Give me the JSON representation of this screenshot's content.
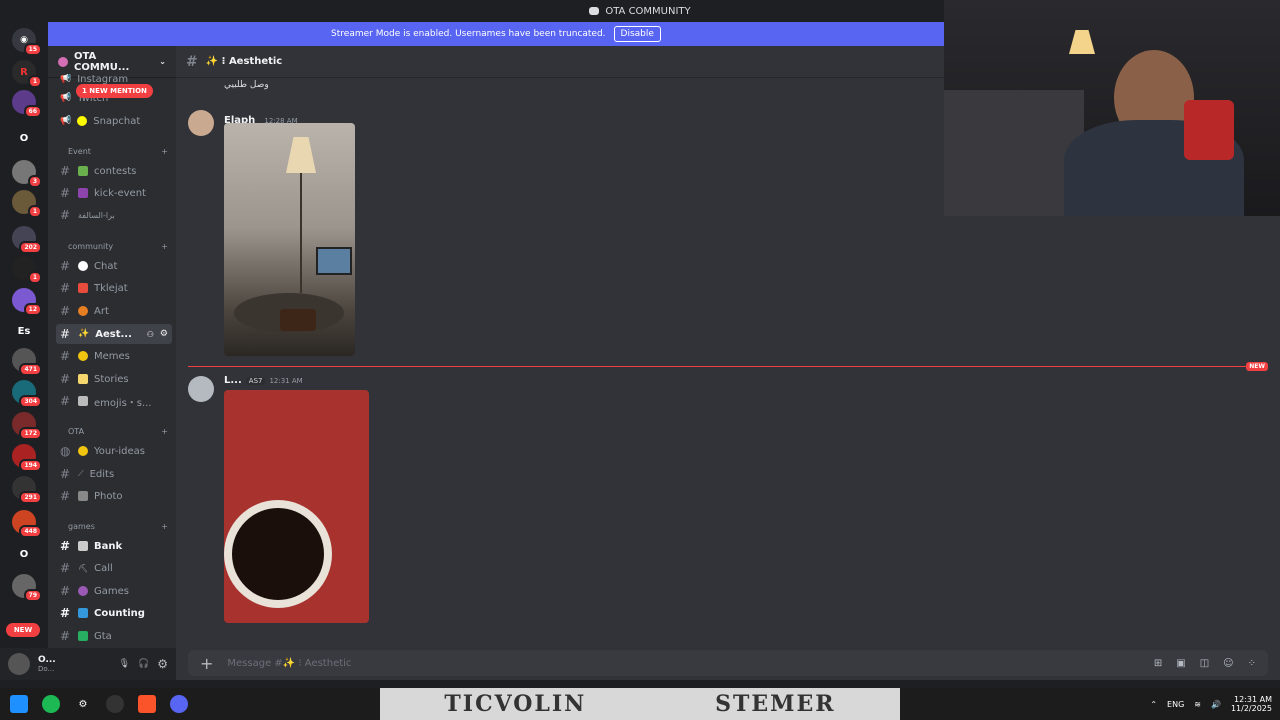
{
  "titlebar": {
    "title": "OTA COMMUNITY"
  },
  "banner": {
    "message": "Streamer Mode is enabled. Usernames have been truncated.",
    "disable_label": "Disable"
  },
  "server_rail": {
    "badges": [
      "15",
      "1",
      "66",
      "3",
      "1",
      "202",
      "1",
      "12",
      "471",
      "304",
      "172",
      "194",
      "291",
      "448",
      "79"
    ],
    "letters": [
      "O",
      "Es",
      "O"
    ],
    "new_label": "NEW"
  },
  "sidebar": {
    "server_name": "OTA COMMU...",
    "mention_pill": "1 NEW MENTION",
    "top_channels": [
      {
        "label": "Instagram"
      },
      {
        "label": "Twitch"
      },
      {
        "label": "Snapchat"
      }
    ],
    "categories": [
      {
        "name": "Event",
        "channels": [
          {
            "label": "contests"
          },
          {
            "label": "kick-event"
          },
          {
            "label": "برا-السالفة"
          }
        ]
      },
      {
        "name": "community",
        "channels": [
          {
            "label": "Chat"
          },
          {
            "label": "Tklejat"
          },
          {
            "label": "Art"
          },
          {
            "label": "Aest..."
          },
          {
            "label": "Memes"
          },
          {
            "label": "Stories"
          },
          {
            "label": "emojis・s..."
          }
        ]
      },
      {
        "name": "OTA",
        "channels": [
          {
            "label": "Your-ideas"
          },
          {
            "label": "Edits"
          },
          {
            "label": "Photo"
          }
        ]
      },
      {
        "name": "games",
        "channels": [
          {
            "label": "Bank"
          },
          {
            "label": "Call"
          },
          {
            "label": "Games"
          },
          {
            "label": "Counting"
          },
          {
            "label": "Gta"
          }
        ]
      }
    ],
    "user": {
      "name": "O...",
      "status": "Do..."
    }
  },
  "channel": {
    "name": "✨ ⁝ Aesthetic"
  },
  "messages": [
    {
      "author": "",
      "time": "",
      "text": "وصل طلبيي"
    },
    {
      "author": "Elaph",
      "time": "12:28 AM",
      "text": ""
    },
    {
      "author": "L...",
      "tag": "AS7",
      "time": "12:31 AM",
      "text": ""
    }
  ],
  "new_divider": "NEW",
  "composer": {
    "placeholder": "Message #✨ ⁝ Aesthetic"
  },
  "taskbar": {
    "lang": "ENG",
    "time": "12:31 AM",
    "date": "11/2/2025",
    "wallpaper_text": [
      "TICVOLIN",
      "STEMER"
    ]
  }
}
